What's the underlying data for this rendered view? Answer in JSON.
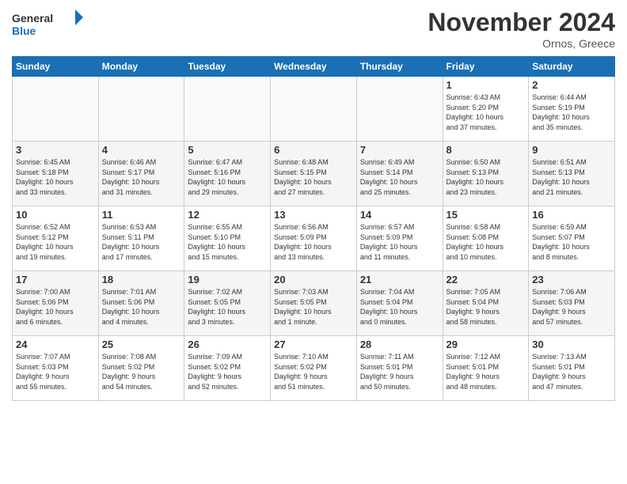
{
  "header": {
    "logo_line1": "General",
    "logo_line2": "Blue",
    "month": "November 2024",
    "location": "Ornos, Greece"
  },
  "weekdays": [
    "Sunday",
    "Monday",
    "Tuesday",
    "Wednesday",
    "Thursday",
    "Friday",
    "Saturday"
  ],
  "weeks": [
    [
      {
        "day": "",
        "info": ""
      },
      {
        "day": "",
        "info": ""
      },
      {
        "day": "",
        "info": ""
      },
      {
        "day": "",
        "info": ""
      },
      {
        "day": "",
        "info": ""
      },
      {
        "day": "1",
        "info": "Sunrise: 6:43 AM\nSunset: 5:20 PM\nDaylight: 10 hours\nand 37 minutes."
      },
      {
        "day": "2",
        "info": "Sunrise: 6:44 AM\nSunset: 5:19 PM\nDaylight: 10 hours\nand 35 minutes."
      }
    ],
    [
      {
        "day": "3",
        "info": "Sunrise: 6:45 AM\nSunset: 5:18 PM\nDaylight: 10 hours\nand 33 minutes."
      },
      {
        "day": "4",
        "info": "Sunrise: 6:46 AM\nSunset: 5:17 PM\nDaylight: 10 hours\nand 31 minutes."
      },
      {
        "day": "5",
        "info": "Sunrise: 6:47 AM\nSunset: 5:16 PM\nDaylight: 10 hours\nand 29 minutes."
      },
      {
        "day": "6",
        "info": "Sunrise: 6:48 AM\nSunset: 5:15 PM\nDaylight: 10 hours\nand 27 minutes."
      },
      {
        "day": "7",
        "info": "Sunrise: 6:49 AM\nSunset: 5:14 PM\nDaylight: 10 hours\nand 25 minutes."
      },
      {
        "day": "8",
        "info": "Sunrise: 6:50 AM\nSunset: 5:13 PM\nDaylight: 10 hours\nand 23 minutes."
      },
      {
        "day": "9",
        "info": "Sunrise: 6:51 AM\nSunset: 5:13 PM\nDaylight: 10 hours\nand 21 minutes."
      }
    ],
    [
      {
        "day": "10",
        "info": "Sunrise: 6:52 AM\nSunset: 5:12 PM\nDaylight: 10 hours\nand 19 minutes."
      },
      {
        "day": "11",
        "info": "Sunrise: 6:53 AM\nSunset: 5:11 PM\nDaylight: 10 hours\nand 17 minutes."
      },
      {
        "day": "12",
        "info": "Sunrise: 6:55 AM\nSunset: 5:10 PM\nDaylight: 10 hours\nand 15 minutes."
      },
      {
        "day": "13",
        "info": "Sunrise: 6:56 AM\nSunset: 5:09 PM\nDaylight: 10 hours\nand 13 minutes."
      },
      {
        "day": "14",
        "info": "Sunrise: 6:57 AM\nSunset: 5:09 PM\nDaylight: 10 hours\nand 11 minutes."
      },
      {
        "day": "15",
        "info": "Sunrise: 6:58 AM\nSunset: 5:08 PM\nDaylight: 10 hours\nand 10 minutes."
      },
      {
        "day": "16",
        "info": "Sunrise: 6:59 AM\nSunset: 5:07 PM\nDaylight: 10 hours\nand 8 minutes."
      }
    ],
    [
      {
        "day": "17",
        "info": "Sunrise: 7:00 AM\nSunset: 5:06 PM\nDaylight: 10 hours\nand 6 minutes."
      },
      {
        "day": "18",
        "info": "Sunrise: 7:01 AM\nSunset: 5:06 PM\nDaylight: 10 hours\nand 4 minutes."
      },
      {
        "day": "19",
        "info": "Sunrise: 7:02 AM\nSunset: 5:05 PM\nDaylight: 10 hours\nand 3 minutes."
      },
      {
        "day": "20",
        "info": "Sunrise: 7:03 AM\nSunset: 5:05 PM\nDaylight: 10 hours\nand 1 minute."
      },
      {
        "day": "21",
        "info": "Sunrise: 7:04 AM\nSunset: 5:04 PM\nDaylight: 10 hours\nand 0 minutes."
      },
      {
        "day": "22",
        "info": "Sunrise: 7:05 AM\nSunset: 5:04 PM\nDaylight: 9 hours\nand 58 minutes."
      },
      {
        "day": "23",
        "info": "Sunrise: 7:06 AM\nSunset: 5:03 PM\nDaylight: 9 hours\nand 57 minutes."
      }
    ],
    [
      {
        "day": "24",
        "info": "Sunrise: 7:07 AM\nSunset: 5:03 PM\nDaylight: 9 hours\nand 55 minutes."
      },
      {
        "day": "25",
        "info": "Sunrise: 7:08 AM\nSunset: 5:02 PM\nDaylight: 9 hours\nand 54 minutes."
      },
      {
        "day": "26",
        "info": "Sunrise: 7:09 AM\nSunset: 5:02 PM\nDaylight: 9 hours\nand 52 minutes."
      },
      {
        "day": "27",
        "info": "Sunrise: 7:10 AM\nSunset: 5:02 PM\nDaylight: 9 hours\nand 51 minutes."
      },
      {
        "day": "28",
        "info": "Sunrise: 7:11 AM\nSunset: 5:01 PM\nDaylight: 9 hours\nand 50 minutes."
      },
      {
        "day": "29",
        "info": "Sunrise: 7:12 AM\nSunset: 5:01 PM\nDaylight: 9 hours\nand 48 minutes."
      },
      {
        "day": "30",
        "info": "Sunrise: 7:13 AM\nSunset: 5:01 PM\nDaylight: 9 hours\nand 47 minutes."
      }
    ]
  ]
}
